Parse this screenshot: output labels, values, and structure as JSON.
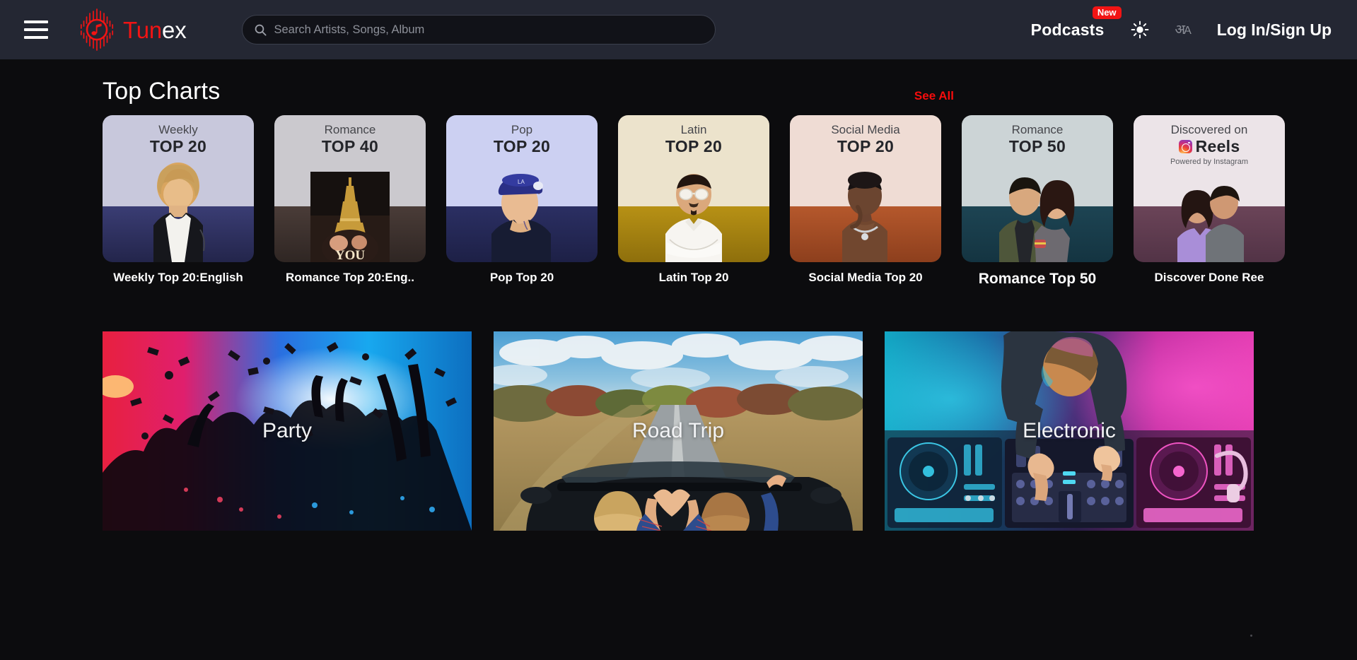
{
  "header": {
    "menu_icon": "hamburger-menu-icon",
    "brand": {
      "part1": "Tun",
      "part2": "ex",
      "logo_icon": "audio-wave-music-note-icon"
    },
    "search": {
      "value": "",
      "placeholder": "Search Artists, Songs, Album",
      "icon": "search-icon"
    },
    "podcasts_label": "Podcasts",
    "podcasts_badge": "New",
    "theme_toggle_icon": "sun-icon",
    "language_toggle": {
      "icon": "language-toggle-icon",
      "devanagari": "अ",
      "latin": "A"
    },
    "login_label": "Log In/Sign Up"
  },
  "top_charts": {
    "title": "Top Charts",
    "see_all": "See All",
    "cards": [
      {
        "kicker": "Weekly",
        "rank": "TOP 20",
        "sub": "",
        "label": "Weekly Top 20:English",
        "top_color": "#c8c8dc",
        "bottom_color": "#3a3d74"
      },
      {
        "kicker": "Romance",
        "rank": "TOP 40",
        "sub": "",
        "label": "Romance Top 20:Eng..",
        "top_color": "#cbc9ce",
        "bottom_color": "#473a37"
      },
      {
        "kicker": "Pop",
        "rank": "TOP 20",
        "sub": "",
        "label": "Pop Top 20",
        "top_color": "#ccd0f2",
        "bottom_color": "#2b2f63"
      },
      {
        "kicker": "Latin",
        "rank": "TOP 20",
        "sub": "",
        "label": "Latin Top 20",
        "top_color": "#ece3cc",
        "bottom_color": "#ab8914"
      },
      {
        "kicker": "Social Media",
        "rank": "TOP 20",
        "sub": "",
        "label": "Social Media Top 20",
        "top_color": "#efdcd4",
        "bottom_color": "#b5582c"
      },
      {
        "kicker": "Romance",
        "rank": "TOP 50",
        "sub": "",
        "label": "Romance Top 50",
        "top_color": "#ccd4d6",
        "bottom_color": "#1d4453"
      },
      {
        "kicker": "Discovered on",
        "rank": "Reels",
        "sub": "Powered by Instagram",
        "label": "Discover Done Ree",
        "top_color": "#ece4e8",
        "bottom_color": "#6b4458"
      }
    ]
  },
  "moods": [
    {
      "title": "Party",
      "image": "party-crowd-confetti-photo"
    },
    {
      "title": "Road Trip",
      "image": "convertible-road-autumn-photo"
    },
    {
      "title": "Electronic",
      "image": "dj-mixing-deck-photo"
    }
  ]
}
